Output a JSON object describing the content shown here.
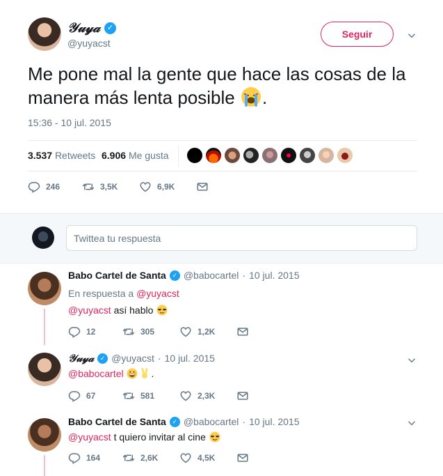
{
  "main_tweet": {
    "display_name": "𝒴𝓊𝓎𝒶",
    "handle": "@yuyacst",
    "follow_label": "Seguir",
    "text": "Me pone mal la gente que hace las cosas de la manera más lenta posible",
    "text_end": ".",
    "timestamp": "15:36 - 10 jul. 2015",
    "retweets_count": "3.537",
    "retweets_label": "Retweets",
    "likes_count": "6.906",
    "likes_label": "Me gusta",
    "actions": {
      "replies": "246",
      "retweets": "3,5K",
      "likes": "6,9K"
    }
  },
  "reply_box": {
    "placeholder": "Twittea tu respuesta"
  },
  "replies": [
    {
      "name": "Babo Cartel de Santa",
      "handle": "@babocartel",
      "sep": "·",
      "date": "10 jul. 2015",
      "in_reply_prefix": "En respuesta a",
      "in_reply_mention": "@yuyacst",
      "mention": "@yuyacst",
      "text": " así hablo",
      "actions": {
        "replies": "12",
        "retweets": "305",
        "likes": "1,2K"
      }
    },
    {
      "name": "𝒴𝓊𝓎𝒶",
      "handle": "@yuyacst",
      "sep": "·",
      "date": "10 jul. 2015",
      "mention": "@babocartel",
      "text": ".",
      "actions": {
        "replies": "67",
        "retweets": "581",
        "likes": "2,3K"
      }
    },
    {
      "name": "Babo Cartel de Santa",
      "handle": "@babocartel",
      "sep": "·",
      "date": "10 jul. 2015",
      "mention": "@yuyacst",
      "text": " t quiero invitar al cine",
      "actions": {
        "replies": "164",
        "retweets": "2,6K",
        "likes": "4,5K"
      }
    }
  ],
  "colors": {
    "accent": "#e0245e",
    "verified": "#1da1f2",
    "muted": "#657786",
    "thread": "#f5bfcf"
  }
}
